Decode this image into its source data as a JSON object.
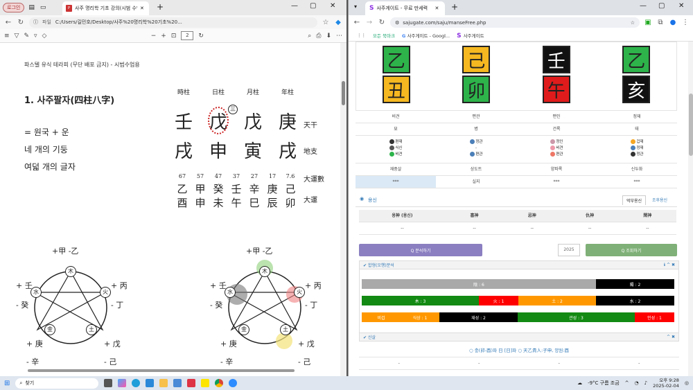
{
  "edge": {
    "profile_label": "로그인",
    "tab_title": "사주 명리학 기초 강의(시범 수업",
    "addr_label": "파일",
    "url": "C:/Users/길민호/Desktop/사주%20명리학%20기초%20...",
    "page_number": "2",
    "pdf_header": "파스텔 유식 테라피 (무단 배포 금지) - 시범수업용",
    "heading": "1. 사주팔자(四柱八字)",
    "lines": [
      "= 원국 + 운",
      "네 개의 기둥",
      "여덟 개의 글자"
    ],
    "pillar_labels": [
      "時柱",
      "日柱",
      "月柱",
      "年柱"
    ],
    "stems": [
      "壬",
      "戊",
      "戊",
      "庚"
    ],
    "branches": [
      "戌",
      "申",
      "寅",
      "戌"
    ],
    "row_label_stems": "天干",
    "row_label_branches": "地支",
    "luck_ages": [
      "67",
      "57",
      "47",
      "37",
      "27",
      "17",
      "7.6"
    ],
    "luck_stems": [
      "乙",
      "甲",
      "癸",
      "壬",
      "辛",
      "庚",
      "己"
    ],
    "luck_branches": [
      "酉",
      "申",
      "未",
      "午",
      "巳",
      "辰",
      "卯"
    ],
    "luck_label_1": "大運數",
    "luck_label_2": "大運",
    "circle_mark": "三",
    "wuxing": {
      "wood": "木",
      "fire": "火",
      "earth": "土",
      "metal": "金",
      "water": "水",
      "wood_lbl": "+甲 -乙",
      "fire_lbl_1": "+ 丙",
      "fire_lbl_2": "- 丁",
      "earth_lbl_1": "+ 戊",
      "earth_lbl_2": "- 己",
      "metal_lbl_1": "+ 庚",
      "metal_lbl_2": "- 辛",
      "water_lbl_1": "+ 壬",
      "water_lbl_2": "- 癸"
    }
  },
  "chrome": {
    "tab_title": "사주게이트 - 무료 만세력",
    "url": "sajugate.com/saju/manseFree.php",
    "bookmarks": [
      "모든 북마크",
      "사주게이트 - Googl...",
      "사주게이트"
    ],
    "stems": [
      {
        "char": "乙",
        "bg": "#2db34a"
      },
      {
        "char": "己",
        "bg": "#f5b820"
      },
      {
        "char": "壬",
        "bg": "#111111"
      },
      {
        "char": "乙",
        "bg": "#2db34a"
      }
    ],
    "branches": [
      {
        "char": "丑",
        "bg": "#f5b820"
      },
      {
        "char": "卯",
        "bg": "#2db34a"
      },
      {
        "char": "午",
        "bg": "#e01b1b"
      },
      {
        "char": "亥",
        "bg": "#111111"
      }
    ],
    "ten_gods": [
      "비견",
      "편관",
      "편인",
      "정재"
    ],
    "row2": [
      "묘",
      "병",
      "건록",
      "태"
    ],
    "hidden": [
      [
        "편재",
        "식신",
        "비견"
      ],
      [
        "정관",
        "-",
        "편관"
      ],
      [
        "정인",
        "비견",
        "편관"
      ],
      [
        "겁재",
        "정재",
        "정관"
      ]
    ],
    "row4": [
      "재중살",
      "상도트",
      "양파록",
      "신두화"
    ],
    "row5": [
      "***",
      "실지",
      "***",
      "***"
    ],
    "yongsin_title": "용신",
    "yongsin_tab_1": "억부용신",
    "yongsin_tab_2": "조후용신",
    "yongsin_cols": [
      "용神 (용신)",
      "喜神",
      "忌神",
      "仇神",
      "閑神"
    ],
    "yongsin_vals": [
      "--",
      "--",
      "--",
      "--",
      "--"
    ],
    "btn_left": "Q 분석하기",
    "year_value": "2025",
    "btn_right": "Q 조회하기",
    "panel1_title": "합형(오행)분석",
    "bar1": [
      "陰 : 6",
      "陽 : 2"
    ],
    "bar2": [
      "木 : 3",
      "火 : 1",
      "土 : 2",
      "水 : 2"
    ],
    "bar3": [
      "비겁",
      "식상 : 1",
      "재성 : 2",
      "관성 : 3",
      "인성 : 1"
    ],
    "panel2_title": "신살",
    "shinsal_text": "○ 충(卯-酉)파 日 [日]파 ○ 天乙貴人:子申, 양원:酉",
    "shinsal_row": [
      "-",
      "-",
      "-",
      "-"
    ],
    "colors": {
      "earth": "#a9a9a9",
      "yin": "#000000",
      "wood": "#138a13",
      "fire": "#ff0000",
      "yellow": "#ff9800",
      "black": "#000000",
      "purple": "#8b7fc1",
      "green": "#7fb077"
    }
  },
  "taskbar": {
    "search": "찾기",
    "weather": "-9°C 구름 조금",
    "time": "오후 9:28",
    "date": "2025-02-04"
  }
}
